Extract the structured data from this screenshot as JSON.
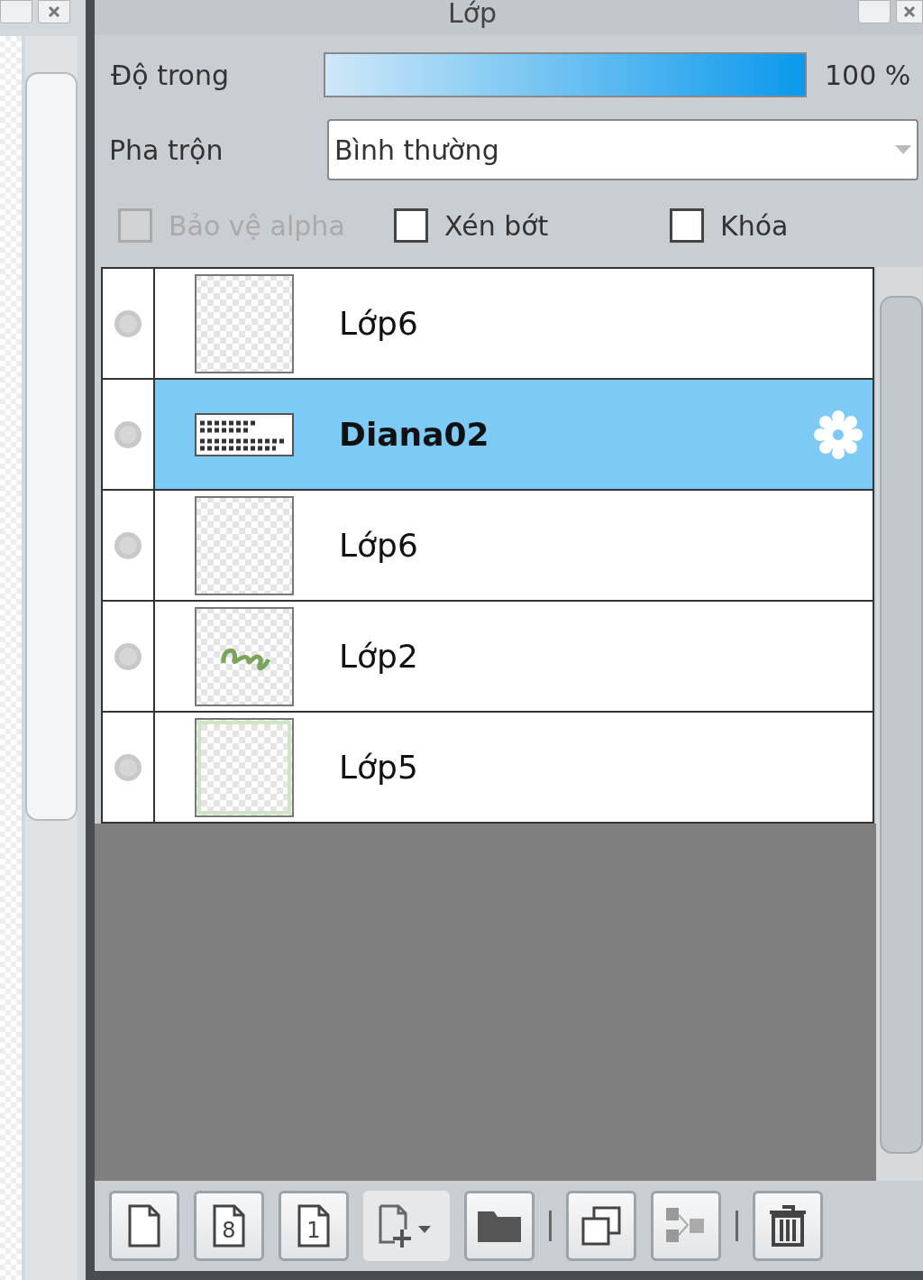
{
  "panel": {
    "title": "Lớp"
  },
  "opacity": {
    "label": "Độ trong",
    "level": 1,
    "reading": "100 %"
  },
  "blend": {
    "label": "Pha trộn",
    "value": "Bình thường"
  },
  "options": [
    {
      "label": "Bảo vệ alpha",
      "checked": false,
      "disabled": true
    },
    {
      "label": "Xén bớt",
      "checked": false,
      "disabled": false
    },
    {
      "label": "Khóa",
      "checked": false,
      "disabled": false
    }
  ],
  "layers": [
    {
      "name": "Lớp6",
      "selected": false,
      "kind": "empty"
    },
    {
      "name": "Diana02",
      "selected": true,
      "kind": "text"
    },
    {
      "name": "Lớp6",
      "selected": false,
      "kind": "empty"
    },
    {
      "name": "Lớp2",
      "selected": false,
      "kind": "script"
    },
    {
      "name": "Lớp5",
      "selected": false,
      "kind": "bordered"
    }
  ],
  "toolbar": [
    {
      "kind": "new"
    },
    {
      "kind": "new",
      "label": "8"
    },
    {
      "kind": "new",
      "label": "1"
    },
    {
      "kind": "add"
    },
    {
      "kind": "folder"
    },
    {
      "kind": "separator"
    },
    {
      "kind": "copy"
    },
    {
      "kind": "merge"
    },
    {
      "kind": "separator"
    },
    {
      "kind": "trash"
    }
  ]
}
